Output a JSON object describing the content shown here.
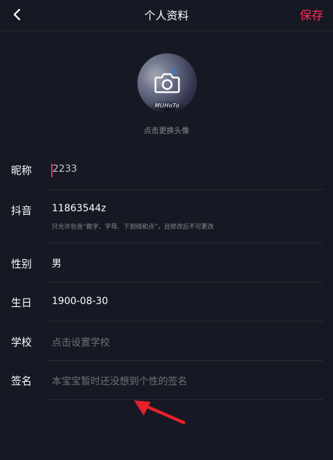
{
  "header": {
    "title": "个人资料",
    "save_label": "保存"
  },
  "avatar": {
    "overlay_text": "MUHoTo",
    "change_hint": "点击更换头像"
  },
  "fields": {
    "nickname": {
      "label": "昵称",
      "value": "2233"
    },
    "douyin_id": {
      "label": "抖音",
      "value": "11863544z",
      "hint": "只允许包含“数字、字母、下划线和点”，且修改后不可更改"
    },
    "gender": {
      "label": "性别",
      "value": "男"
    },
    "birthday": {
      "label": "生日",
      "value": "1900-08-30"
    },
    "school": {
      "label": "学校",
      "placeholder": "点击设置学校"
    },
    "signature": {
      "label": "签名",
      "placeholder": "本宝宝暂时还没想到个性的签名"
    }
  },
  "colors": {
    "background": "#161823",
    "accent": "#fe2c55",
    "annotation_arrow": "#e8202a"
  }
}
